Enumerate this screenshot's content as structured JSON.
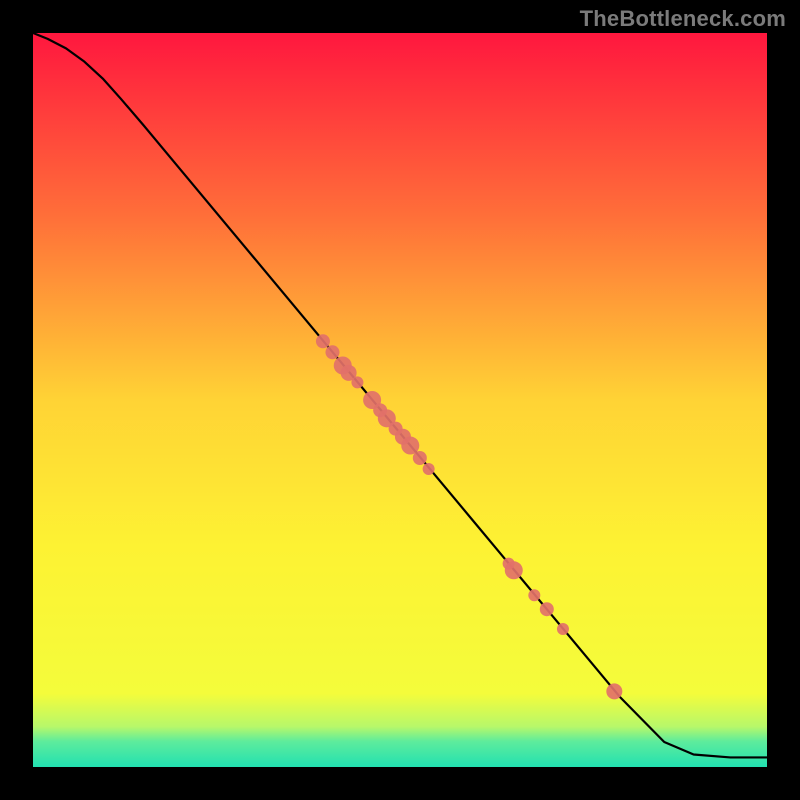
{
  "watermark": "TheBottleneck.com",
  "chart_data": {
    "type": "line",
    "title": "",
    "xlabel": "",
    "ylabel": "",
    "xlim": [
      0,
      100
    ],
    "ylim": [
      0,
      100
    ],
    "background_gradient": {
      "stops": [
        {
          "offset": 0.0,
          "color": "#ff173e"
        },
        {
          "offset": 0.25,
          "color": "#ff6f39"
        },
        {
          "offset": 0.5,
          "color": "#ffd335"
        },
        {
          "offset": 0.7,
          "color": "#fdf233"
        },
        {
          "offset": 0.9,
          "color": "#f4fc3b"
        },
        {
          "offset": 0.945,
          "color": "#b7f86a"
        },
        {
          "offset": 0.965,
          "color": "#5eec9c"
        },
        {
          "offset": 1.0,
          "color": "#22e1b1"
        }
      ]
    },
    "series": [
      {
        "name": "curve",
        "type": "line",
        "color": "#000000",
        "x": [
          0.0,
          2.0,
          4.5,
          7.0,
          9.5,
          12.0,
          15.0,
          20.0,
          30.0,
          40.0,
          50.0,
          60.0,
          70.0,
          80.0,
          86.0,
          90.0,
          95.0,
          100.0
        ],
        "y": [
          100.0,
          99.2,
          97.9,
          96.1,
          93.8,
          91.0,
          87.5,
          81.5,
          69.5,
          57.5,
          45.5,
          33.5,
          21.5,
          9.5,
          3.4,
          1.7,
          1.3,
          1.3
        ]
      },
      {
        "name": "markers",
        "type": "scatter",
        "color": "#e27169",
        "points": [
          {
            "x": 39.5,
            "y": 58.0,
            "r": 7
          },
          {
            "x": 40.8,
            "y": 56.5,
            "r": 7
          },
          {
            "x": 42.2,
            "y": 54.7,
            "r": 9
          },
          {
            "x": 43.0,
            "y": 53.7,
            "r": 8
          },
          {
            "x": 44.2,
            "y": 52.4,
            "r": 6
          },
          {
            "x": 46.2,
            "y": 50.0,
            "r": 9
          },
          {
            "x": 47.3,
            "y": 48.6,
            "r": 7
          },
          {
            "x": 48.2,
            "y": 47.5,
            "r": 9
          },
          {
            "x": 49.4,
            "y": 46.1,
            "r": 7
          },
          {
            "x": 50.4,
            "y": 45.0,
            "r": 8
          },
          {
            "x": 51.4,
            "y": 43.8,
            "r": 9
          },
          {
            "x": 52.7,
            "y": 42.1,
            "r": 7
          },
          {
            "x": 53.9,
            "y": 40.6,
            "r": 6
          },
          {
            "x": 64.8,
            "y": 27.7,
            "r": 6
          },
          {
            "x": 65.5,
            "y": 26.8,
            "r": 9
          },
          {
            "x": 68.3,
            "y": 23.4,
            "r": 6
          },
          {
            "x": 70.0,
            "y": 21.5,
            "r": 7
          },
          {
            "x": 72.2,
            "y": 18.8,
            "r": 6
          },
          {
            "x": 79.2,
            "y": 10.3,
            "r": 8
          }
        ]
      }
    ]
  }
}
